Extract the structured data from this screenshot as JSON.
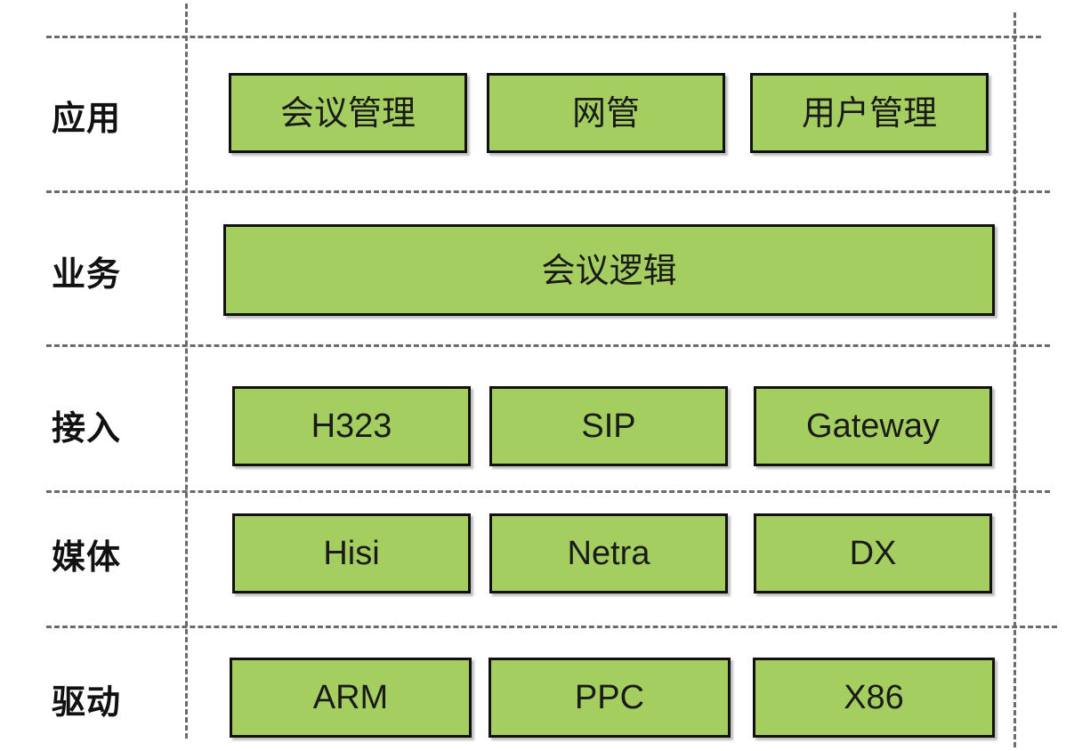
{
  "layers": [
    {
      "label": "应用",
      "modules": [
        "会议管理",
        "网管",
        "用户管理"
      ]
    },
    {
      "label": "业务",
      "modules": [
        "会议逻辑"
      ]
    },
    {
      "label": "接入",
      "modules": [
        "H323",
        "SIP",
        "Gateway"
      ]
    },
    {
      "label": "媒体",
      "modules": [
        "Hisi",
        "Netra",
        "DX"
      ]
    },
    {
      "label": "驱动",
      "modules": [
        "ARM",
        "PPC",
        "X86"
      ]
    }
  ],
  "colors": {
    "box_fill": "#a4cf60",
    "box_border": "#111111",
    "divider": "#6b6b6b"
  }
}
